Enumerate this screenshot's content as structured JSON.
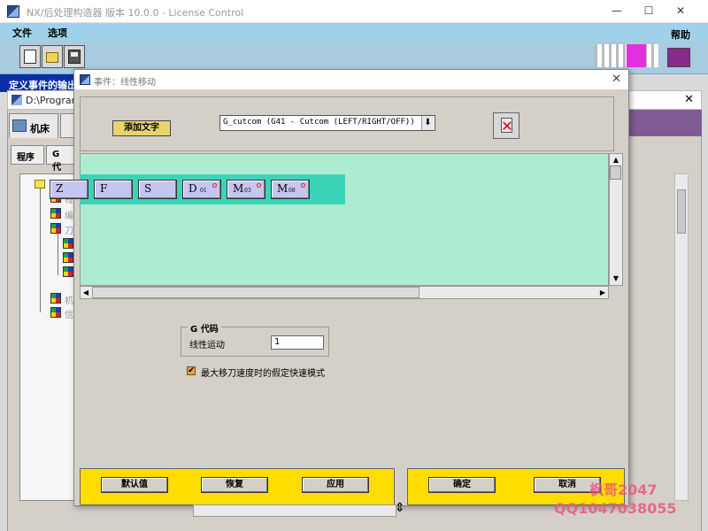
{
  "main_window": {
    "title": "NX/后处理构造器 版本 10.0.0 - License Control",
    "controls": {
      "minimize": "—",
      "maximize": "☐",
      "close": "✕"
    },
    "menu": [
      "文件",
      "选项"
    ],
    "help": "帮助",
    "event_output_label": "定义事件的输出"
  },
  "sub_window": {
    "title": "D:\\Program",
    "close": "✕",
    "machine_tab": "机床",
    "tabs": [
      "程序",
      "G 代"
    ],
    "tree_items": [
      "程",
      "编",
      "刀",
      "",
      "",
      "",
      "机",
      "信"
    ]
  },
  "dialog": {
    "title": "事件：线性移动",
    "close": "✕",
    "add_text_label": "添加文字",
    "address_select_value": "G_cutcom (G41 - Cutcom (LEFT/RIGHT/OFF))",
    "dropdown_arrow": "⬇",
    "blocks": [
      {
        "letter": "Z",
        "sub": "",
        "dot": false
      },
      {
        "letter": "F",
        "sub": "",
        "dot": false
      },
      {
        "letter": "S",
        "sub": "",
        "dot": false
      },
      {
        "letter": "D",
        "sub": "01",
        "dot": true
      },
      {
        "letter": "M",
        "sub": "03",
        "dot": true
      },
      {
        "letter": "M",
        "sub": "08",
        "dot": true
      }
    ],
    "gcode_group_title": "G 代码",
    "linear_motion_label": "线性运动",
    "linear_motion_value": "1",
    "rapid_mode_label": "最大移刀速度时的假定快速模式",
    "rapid_mode_checked": true,
    "buttons_left": [
      "默认值",
      "恢复",
      "应用"
    ],
    "buttons_right": [
      "确定",
      "取消"
    ]
  },
  "watermark": {
    "name": "枫哥2047",
    "qq": "QQ1047038055"
  },
  "colors": {
    "canvas": "#aeecd2",
    "block_strip": "#3bd4b8",
    "button_bar": "#ffdd00",
    "menubar": "#9fd2ea"
  }
}
